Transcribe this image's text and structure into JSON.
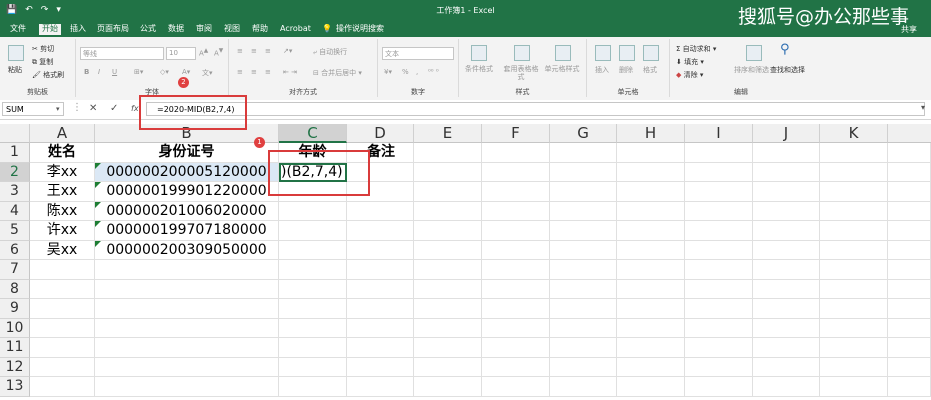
{
  "window": {
    "title": "工作簿1 - Excel",
    "watermark": "搜狐号@办公那些事",
    "share": "共享"
  },
  "qat": [
    "💾",
    "↶",
    "↷",
    "▾"
  ],
  "tabs": [
    {
      "label": "文件"
    },
    {
      "label": "开始"
    },
    {
      "label": "插入"
    },
    {
      "label": "页面布局"
    },
    {
      "label": "公式"
    },
    {
      "label": "数据"
    },
    {
      "label": "审阅"
    },
    {
      "label": "视图"
    },
    {
      "label": "帮助"
    },
    {
      "label": "Acrobat"
    },
    {
      "label": "操作说明搜索"
    }
  ],
  "ribbon": {
    "clipboard": {
      "label": "剪贴板",
      "paste": "粘贴",
      "cut": "剪切",
      "copy": "复制",
      "format_painter": "格式刷"
    },
    "font": {
      "label": "字体",
      "font_name": "等线",
      "font_size": "10",
      "bold": "B",
      "italic": "I",
      "underline": "U"
    },
    "alignment": {
      "label": "对齐方式",
      "wrap": "自动换行",
      "merge": "合并后居中"
    },
    "number": {
      "label": "数字",
      "format": "文本",
      "percent": "%",
      "comma": ","
    },
    "styles": {
      "label": "样式",
      "conditional": "条件格式",
      "table": "套用表格格式",
      "cell_styles": "单元格样式"
    },
    "cells": {
      "label": "单元格",
      "insert": "插入",
      "delete": "删除",
      "format": "格式"
    },
    "editing": {
      "label": "编辑",
      "autosum": "自动求和",
      "fill": "填充",
      "clear": "清除",
      "sort": "排序和筛选",
      "find": "查找和选择"
    }
  },
  "formula_bar": {
    "name_box": "SUM",
    "cancel": "✕",
    "enter": "✓",
    "fx": "fx",
    "formula": "=2020-MID(B2,7,4)"
  },
  "badges": {
    "one": "1",
    "two": "2"
  },
  "columns": [
    "A",
    "B",
    "C",
    "D",
    "E",
    "F",
    "G",
    "H",
    "I",
    "J",
    "K"
  ],
  "rows": [
    "1",
    "2",
    "3",
    "4",
    "5",
    "6",
    "7",
    "8",
    "9",
    "10",
    "11",
    "12",
    "13"
  ],
  "sheet": {
    "headers": {
      "a": "姓名",
      "b": "身份证号",
      "c": "年龄",
      "d": "备注"
    },
    "data": [
      {
        "name": "李xx",
        "id": "000000200005120000",
        "age": ")(B2,7,4)"
      },
      {
        "name": "王xx",
        "id": "000000199901220000",
        "age": ""
      },
      {
        "name": "陈xx",
        "id": "000000201006020000",
        "age": ""
      },
      {
        "name": "许xx",
        "id": "000000199707180000",
        "age": ""
      },
      {
        "name": "吴xx",
        "id": "000000200309050000",
        "age": ""
      }
    ]
  },
  "colors": {
    "excel_green": "#217346",
    "highlight_red": "#d93b3b"
  }
}
